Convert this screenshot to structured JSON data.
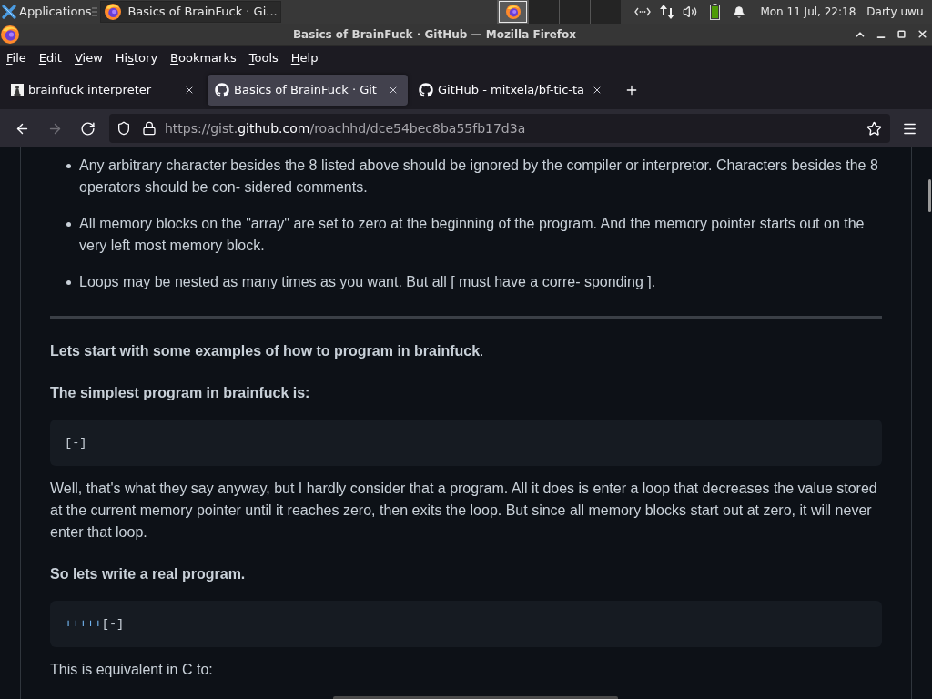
{
  "taskbar": {
    "apps_menu": "Applications",
    "windows": [
      {
        "title": "Basics of BrainFuck · Gi...",
        "selected": true
      }
    ],
    "workspaces": [
      {
        "selected": true,
        "kind": "app"
      },
      {
        "selected": false,
        "kind": "empty"
      },
      {
        "selected": false,
        "kind": "empty"
      },
      {
        "selected": false,
        "kind": "empty"
      }
    ],
    "clock": "Mon 11 Jul, 22:18",
    "user": "Darty uwu"
  },
  "window": {
    "title": "Basics of BrainFuck · GitHub — Mozilla Firefox"
  },
  "menu": [
    {
      "key": "F",
      "post": "ile"
    },
    {
      "key": "E",
      "post": "dit"
    },
    {
      "key": "V",
      "post": "iew"
    },
    {
      "pre": "Hi",
      "key": "s",
      "post": "tory"
    },
    {
      "key": "B",
      "post": "ookmarks"
    },
    {
      "key": "T",
      "post": "ools"
    },
    {
      "key": "H",
      "post": "elp"
    }
  ],
  "tabs": [
    {
      "label": "brainfuck interpreter",
      "selected": false,
      "kind": "custom"
    },
    {
      "label": "Basics of BrainFuck · Git",
      "selected": true,
      "kind": "github"
    },
    {
      "label": "GitHub - mitxela/bf-tic-ta",
      "selected": false,
      "kind": "github"
    }
  ],
  "nav_buttons": [
    {
      "kind": "back",
      "disabled": false
    },
    {
      "kind": "forward",
      "disabled": true
    },
    {
      "kind": "reload",
      "disabled": false
    }
  ],
  "address_bar": {
    "prefix": "https://gist.",
    "domain": "github.com",
    "path": "/roachhd/dce54bec8ba55fb17d3a"
  },
  "content": [
    {
      "kind": "list",
      "items": [
        "Any arbitrary character besides the 8 listed above should be ignored by the compiler or interpretor. Characters besides the 8 operators should be con- sidered comments.",
        "All memory blocks on the \"array\" are set to zero at the beginning of the program. And the memory pointer starts out on the very left most memory block.",
        "Loops may be nested as many times as you want. But all [ must have a corre- sponding ]."
      ]
    },
    {
      "kind": "rule"
    },
    {
      "kind": "paragraph",
      "text": "**Lets start with some examples of how to program in brainfuck**.",
      "bold": false
    },
    {
      "kind": "paragraph",
      "text": "The simplest program in brainfuck is:",
      "bold": true
    },
    {
      "kind": "code",
      "tokens": [
        {
          "text": "[-]",
          "kind": "plain"
        }
      ]
    },
    {
      "kind": "paragraph",
      "text": "Well, that's what they say anyway, but I hardly consider that a program. All it does is enter a loop that decreases the value stored at the current memory pointer until it reaches zero, then exits the loop. But since all memory blocks start out at zero, it will never enter that loop.",
      "bold": false
    },
    {
      "kind": "paragraph",
      "text": "So lets write a real program.",
      "bold": true
    },
    {
      "kind": "code",
      "tokens": [
        {
          "text": "+++++",
          "kind": "operator"
        },
        {
          "text": "[-]",
          "kind": "plain"
        }
      ]
    },
    {
      "kind": "paragraph",
      "text": "This is equivalent in C to:",
      "bold": false
    }
  ]
}
